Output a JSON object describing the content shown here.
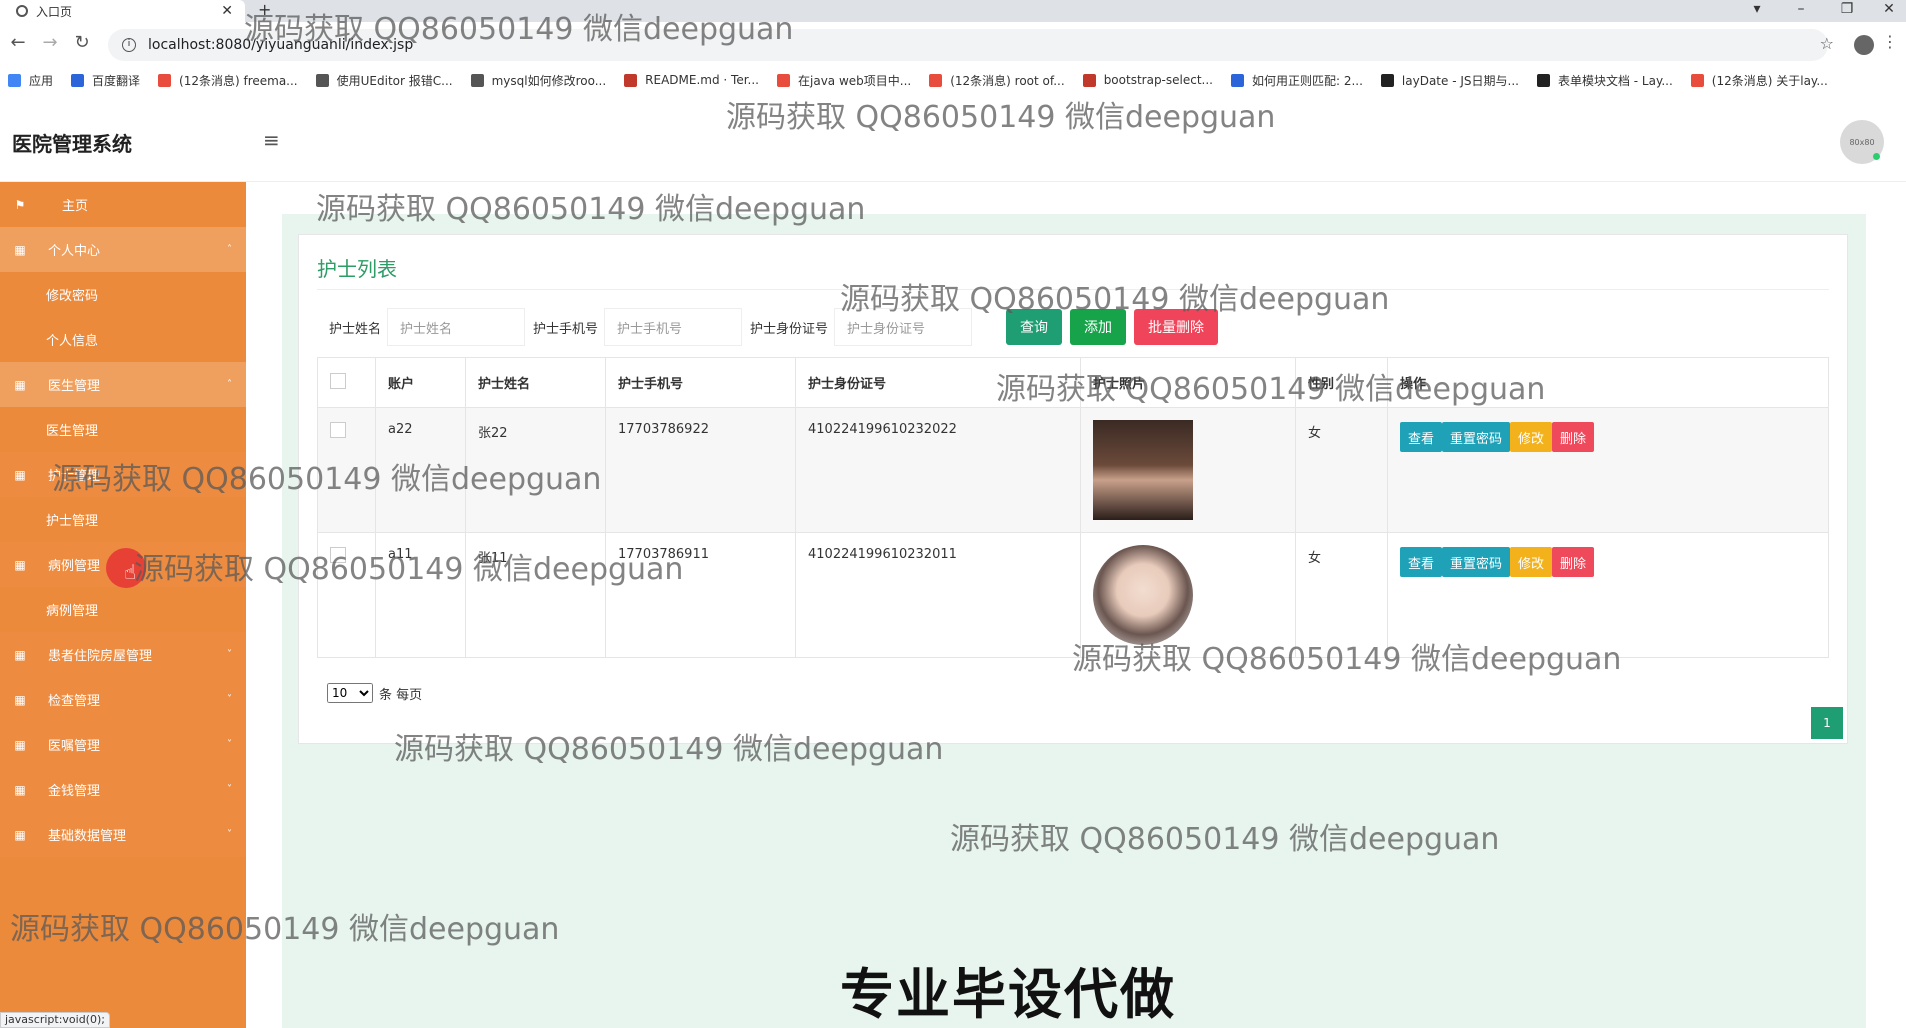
{
  "browser": {
    "tab_title": "入口页",
    "url": "localhost:8080/yiyuanguanli/index.jsp",
    "bookmarks": [
      {
        "label": "应用",
        "color": "#4285f4"
      },
      {
        "label": "百度翻译",
        "color": "#2b65d9"
      },
      {
        "label": "(12条消息) freema...",
        "color": "#e74c3c"
      },
      {
        "label": "使用UEditor 报错C...",
        "color": "#555555"
      },
      {
        "label": "mysql如何修改roo...",
        "color": "#555555"
      },
      {
        "label": "README.md · Ter...",
        "color": "#c0392b"
      },
      {
        "label": "在java web项目中...",
        "color": "#e74c3c"
      },
      {
        "label": "(12条消息) root of...",
        "color": "#e74c3c"
      },
      {
        "label": "bootstrap-select...",
        "color": "#c0392b"
      },
      {
        "label": "如何用正则匹配: 2...",
        "color": "#2b65d9"
      },
      {
        "label": "layDate - JS日期与...",
        "color": "#222222"
      },
      {
        "label": "表单模块文档 - Lay...",
        "color": "#222222"
      },
      {
        "label": "(12条消息) 关于lay...",
        "color": "#e74c3c"
      }
    ],
    "status_text": "javascript:void(0);"
  },
  "app": {
    "title": "医院管理系统",
    "avatar_text": "80x80"
  },
  "sidebar": {
    "items": [
      {
        "label": "主页",
        "type": "top",
        "icon": "flag-icon"
      },
      {
        "label": "个人中心",
        "type": "group",
        "icon": "grid-icon",
        "arrow": "˄"
      },
      {
        "label": "修改密码",
        "type": "sub"
      },
      {
        "label": "个人信息",
        "type": "sub"
      },
      {
        "label": "医生管理",
        "type": "group",
        "icon": "grid-icon",
        "arrow": "˄"
      },
      {
        "label": "医生管理",
        "type": "sub"
      },
      {
        "label": "护士管理",
        "type": "group",
        "icon": "grid-icon",
        "arrow": ""
      },
      {
        "label": "护士管理",
        "type": "sub"
      },
      {
        "label": "病例管理",
        "type": "group",
        "icon": "grid-icon",
        "arrow": ""
      },
      {
        "label": "病例管理",
        "type": "sub"
      },
      {
        "label": "患者住院房屋管理",
        "type": "group",
        "icon": "grid-icon",
        "arrow": "˅"
      },
      {
        "label": "检查管理",
        "type": "group",
        "icon": "grid-icon",
        "arrow": "˅"
      },
      {
        "label": "医嘱管理",
        "type": "group",
        "icon": "grid-icon",
        "arrow": "˅"
      },
      {
        "label": "金钱管理",
        "type": "group",
        "icon": "grid-icon",
        "arrow": "˅"
      },
      {
        "label": "基础数据管理",
        "type": "group",
        "icon": "grid-icon",
        "arrow": "˅"
      }
    ]
  },
  "main": {
    "card_title": "护士列表",
    "search": {
      "name_label": "护士姓名",
      "name_placeholder": "护士姓名",
      "phone_label": "护士手机号",
      "phone_placeholder": "护士手机号",
      "idcard_label": "护士身份证号",
      "idcard_placeholder": "护士身份证号",
      "query_btn": "查询",
      "add_btn": "添加",
      "batch_delete_btn": "批量删除"
    },
    "table": {
      "columns": [
        "账户",
        "护士姓名",
        "护士手机号",
        "护士身份证号",
        "护士照片",
        "性别",
        "操作"
      ],
      "rows": [
        {
          "account": "a22",
          "name": "张22",
          "phone": "17703786922",
          "idcard": "410224199610232022",
          "photo": "man-portrait",
          "gender": "女"
        },
        {
          "account": "a11",
          "name": "张11",
          "phone": "17703786911",
          "idcard": "410224199610232011",
          "photo": "woman-portrait",
          "gender": "女"
        }
      ],
      "ops": {
        "view": "查看",
        "reset": "重置密码",
        "edit": "修改",
        "delete": "删除"
      }
    },
    "pager": {
      "size": "10",
      "size_suffix": "条 每页",
      "current_page": "1"
    }
  },
  "overlay": {
    "watermark": "源码获取 QQ86050149 微信deepguan",
    "promo": "专业毕设代做"
  }
}
